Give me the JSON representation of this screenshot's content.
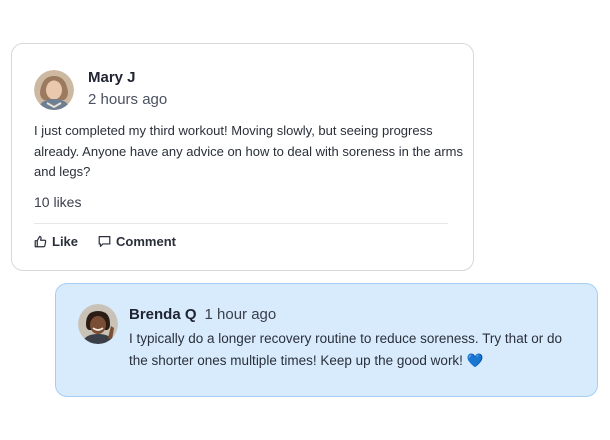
{
  "post": {
    "author": "Mary J",
    "time": "2 hours ago",
    "body": "I just completed my third workout! Moving slowly, but seeing progress already. Anyone have any advice on how to deal with soreness in the arms and legs?",
    "likes": "10 likes",
    "like_label": "Like",
    "comment_label": "Comment"
  },
  "reply": {
    "author": "Brenda Q",
    "time": "1 hour ago",
    "body": "I typically do a longer recovery routine to reduce soreness. Try that or do the shorter ones multiple times! Keep up the good work!",
    "emoji": "💙"
  },
  "colors": {
    "reply_background": "#d8ebfd",
    "reply_border": "#a9cdf2",
    "card_border": "#d6d8dc"
  },
  "icons": {
    "like": "thumbs-up-icon",
    "comment": "speech-bubble-icon"
  }
}
